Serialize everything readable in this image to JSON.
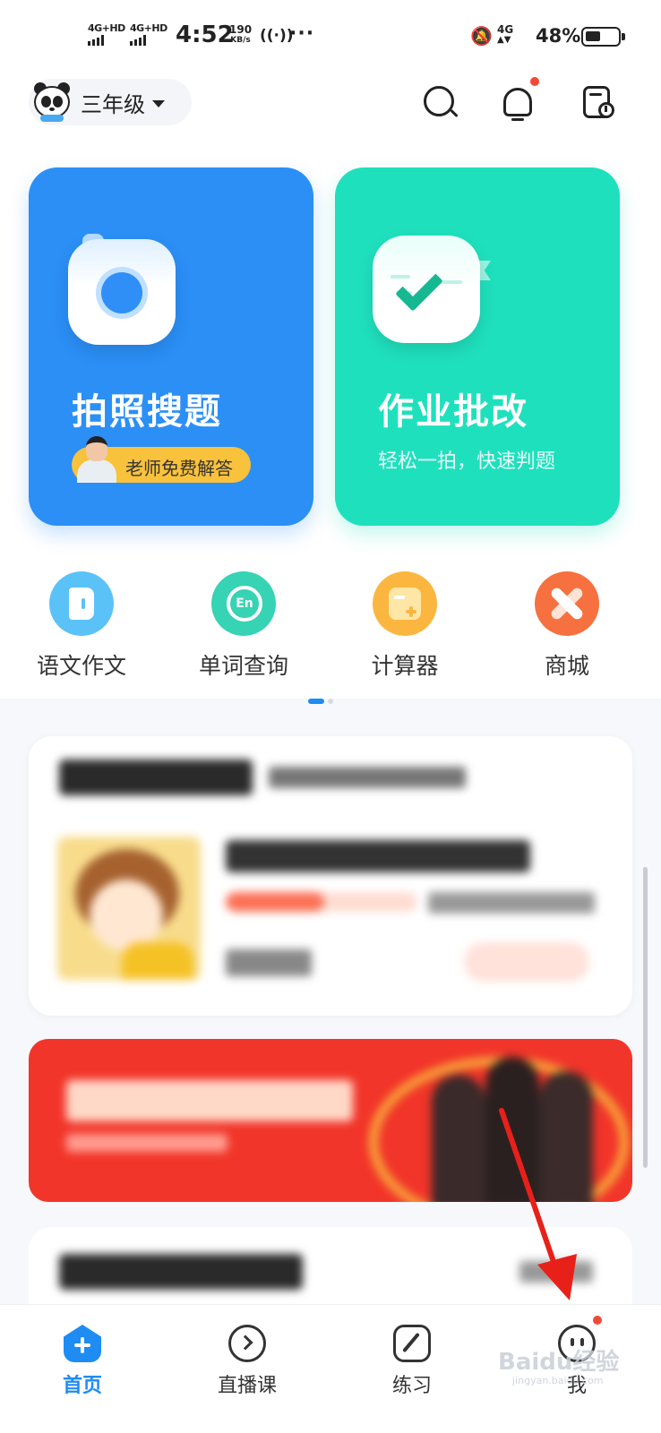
{
  "status_bar": {
    "network1": "4G+HD",
    "network2": "4G+HD",
    "time": "4:52",
    "speed_value": "190",
    "speed_unit": "KB/s",
    "network3": "4G",
    "battery_percent": "48%",
    "battery_level": 0.48
  },
  "header": {
    "grade": "三年级"
  },
  "cards": {
    "photo_search": {
      "title": "拍照搜题",
      "teacher_badge": "老师免费解答",
      "color": "#2b8ff6"
    },
    "homework_check": {
      "title": "作业批改",
      "subtitle": "轻松一拍，快速判题",
      "color": "#1fe0bd"
    }
  },
  "tools": [
    {
      "label": "语文作文",
      "icon": "essay-icon",
      "color": "#5ac2f7"
    },
    {
      "label": "单词查询",
      "icon": "word-lookup-icon",
      "icon_text": "En",
      "color": "#36d3b4"
    },
    {
      "label": "计算器",
      "icon": "calculator-icon",
      "color": "#fbb640"
    },
    {
      "label": "商城",
      "icon": "mall-icon",
      "color": "#f6713f"
    }
  ],
  "pager": {
    "pages": 2,
    "active": 1
  },
  "bottom_nav": [
    {
      "label": "首页",
      "icon": "home-icon",
      "active": true
    },
    {
      "label": "直播课",
      "icon": "live-course-icon",
      "active": false
    },
    {
      "label": "练习",
      "icon": "practice-icon",
      "active": false
    },
    {
      "label": "我",
      "icon": "profile-icon",
      "active": false,
      "badge": true
    }
  ],
  "watermark": {
    "logo": "Baidu经验",
    "url": "jingyan.baidu.com"
  },
  "colors": {
    "accent": "#1e8cf3",
    "badge_red": "#f04a37"
  }
}
